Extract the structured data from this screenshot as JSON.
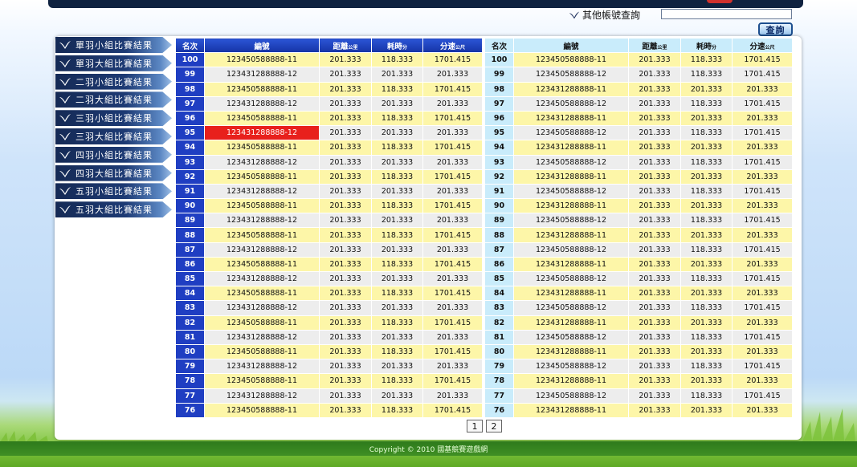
{
  "search": {
    "label": "其他帳號查詢",
    "input_value": "",
    "button_label": "查詢"
  },
  "sidebar": {
    "items": [
      {
        "label": "單羽小組比賽結果"
      },
      {
        "label": "單羽大組比賽結果"
      },
      {
        "label": "二羽小組比賽結果"
      },
      {
        "label": "二羽大組比賽結果"
      },
      {
        "label": "三羽小組比賽結果"
      },
      {
        "label": "三羽大組比賽結果"
      },
      {
        "label": "四羽小組比賽結果"
      },
      {
        "label": "四羽大組比賽結果"
      },
      {
        "label": "五羽小組比賽結果"
      },
      {
        "label": "五羽大組比賽結果"
      }
    ]
  },
  "table": {
    "headers": {
      "rank": "名次",
      "code": "編號",
      "distance": "距離",
      "distance_unit": "公里",
      "time": "耗時",
      "time_unit": "分",
      "speed": "分速",
      "speed_unit": "公尺"
    },
    "highlighted": {
      "rank": "95",
      "side": "left"
    },
    "left_rows": [
      {
        "rank": "100",
        "code": "123450588888-11",
        "distance": "201.333",
        "time": "118.333",
        "speed": "1701.415"
      },
      {
        "rank": "99",
        "code": "123431288888-12",
        "distance": "201.333",
        "time": "201.333",
        "speed": "201.333"
      },
      {
        "rank": "98",
        "code": "123450588888-11",
        "distance": "201.333",
        "time": "118.333",
        "speed": "1701.415"
      },
      {
        "rank": "97",
        "code": "123431288888-12",
        "distance": "201.333",
        "time": "201.333",
        "speed": "201.333"
      },
      {
        "rank": "96",
        "code": "123450588888-11",
        "distance": "201.333",
        "time": "118.333",
        "speed": "1701.415"
      },
      {
        "rank": "95",
        "code": "123431288888-12",
        "distance": "201.333",
        "time": "201.333",
        "speed": "201.333"
      },
      {
        "rank": "94",
        "code": "123450588888-11",
        "distance": "201.333",
        "time": "118.333",
        "speed": "1701.415"
      },
      {
        "rank": "93",
        "code": "123431288888-12",
        "distance": "201.333",
        "time": "201.333",
        "speed": "201.333"
      },
      {
        "rank": "92",
        "code": "123450588888-11",
        "distance": "201.333",
        "time": "118.333",
        "speed": "1701.415"
      },
      {
        "rank": "91",
        "code": "123431288888-12",
        "distance": "201.333",
        "time": "201.333",
        "speed": "201.333"
      },
      {
        "rank": "90",
        "code": "123450588888-11",
        "distance": "201.333",
        "time": "118.333",
        "speed": "1701.415"
      },
      {
        "rank": "89",
        "code": "123431288888-12",
        "distance": "201.333",
        "time": "201.333",
        "speed": "201.333"
      },
      {
        "rank": "88",
        "code": "123450588888-11",
        "distance": "201.333",
        "time": "118.333",
        "speed": "1701.415"
      },
      {
        "rank": "87",
        "code": "123431288888-12",
        "distance": "201.333",
        "time": "201.333",
        "speed": "201.333"
      },
      {
        "rank": "86",
        "code": "123450588888-11",
        "distance": "201.333",
        "time": "118.333",
        "speed": "1701.415"
      },
      {
        "rank": "85",
        "code": "123431288888-12",
        "distance": "201.333",
        "time": "201.333",
        "speed": "201.333"
      },
      {
        "rank": "84",
        "code": "123450588888-11",
        "distance": "201.333",
        "time": "118.333",
        "speed": "1701.415"
      },
      {
        "rank": "83",
        "code": "123431288888-12",
        "distance": "201.333",
        "time": "201.333",
        "speed": "201.333"
      },
      {
        "rank": "82",
        "code": "123450588888-11",
        "distance": "201.333",
        "time": "118.333",
        "speed": "1701.415"
      },
      {
        "rank": "81",
        "code": "123431288888-12",
        "distance": "201.333",
        "time": "201.333",
        "speed": "201.333"
      },
      {
        "rank": "80",
        "code": "123450588888-11",
        "distance": "201.333",
        "time": "118.333",
        "speed": "1701.415"
      },
      {
        "rank": "79",
        "code": "123431288888-12",
        "distance": "201.333",
        "time": "201.333",
        "speed": "201.333"
      },
      {
        "rank": "78",
        "code": "123450588888-11",
        "distance": "201.333",
        "time": "118.333",
        "speed": "1701.415"
      },
      {
        "rank": "77",
        "code": "123431288888-12",
        "distance": "201.333",
        "time": "201.333",
        "speed": "201.333"
      },
      {
        "rank": "76",
        "code": "123450588888-11",
        "distance": "201.333",
        "time": "118.333",
        "speed": "1701.415"
      }
    ],
    "right_rows": [
      {
        "rank": "100",
        "code": "123450588888-11",
        "distance": "201.333",
        "time": "118.333",
        "speed": "1701.415"
      },
      {
        "rank": "99",
        "code": "123450588888-12",
        "distance": "201.333",
        "time": "118.333",
        "speed": "1701.415"
      },
      {
        "rank": "98",
        "code": "123431288888-11",
        "distance": "201.333",
        "time": "201.333",
        "speed": "201.333"
      },
      {
        "rank": "97",
        "code": "123450588888-12",
        "distance": "201.333",
        "time": "118.333",
        "speed": "1701.415"
      },
      {
        "rank": "96",
        "code": "123431288888-11",
        "distance": "201.333",
        "time": "201.333",
        "speed": "201.333"
      },
      {
        "rank": "95",
        "code": "123450588888-12",
        "distance": "201.333",
        "time": "118.333",
        "speed": "1701.415"
      },
      {
        "rank": "94",
        "code": "123431288888-11",
        "distance": "201.333",
        "time": "201.333",
        "speed": "201.333"
      },
      {
        "rank": "93",
        "code": "123450588888-12",
        "distance": "201.333",
        "time": "118.333",
        "speed": "1701.415"
      },
      {
        "rank": "92",
        "code": "123431288888-11",
        "distance": "201.333",
        "time": "201.333",
        "speed": "201.333"
      },
      {
        "rank": "91",
        "code": "123450588888-12",
        "distance": "201.333",
        "time": "118.333",
        "speed": "1701.415"
      },
      {
        "rank": "90",
        "code": "123431288888-11",
        "distance": "201.333",
        "time": "201.333",
        "speed": "201.333"
      },
      {
        "rank": "89",
        "code": "123450588888-12",
        "distance": "201.333",
        "time": "118.333",
        "speed": "1701.415"
      },
      {
        "rank": "88",
        "code": "123431288888-11",
        "distance": "201.333",
        "time": "201.333",
        "speed": "201.333"
      },
      {
        "rank": "87",
        "code": "123450588888-12",
        "distance": "201.333",
        "time": "118.333",
        "speed": "1701.415"
      },
      {
        "rank": "86",
        "code": "123431288888-11",
        "distance": "201.333",
        "time": "201.333",
        "speed": "201.333"
      },
      {
        "rank": "85",
        "code": "123450588888-12",
        "distance": "201.333",
        "time": "118.333",
        "speed": "1701.415"
      },
      {
        "rank": "84",
        "code": "123431288888-11",
        "distance": "201.333",
        "time": "201.333",
        "speed": "201.333"
      },
      {
        "rank": "83",
        "code": "123450588888-12",
        "distance": "201.333",
        "time": "118.333",
        "speed": "1701.415"
      },
      {
        "rank": "82",
        "code": "123431288888-11",
        "distance": "201.333",
        "time": "201.333",
        "speed": "201.333"
      },
      {
        "rank": "81",
        "code": "123450588888-12",
        "distance": "201.333",
        "time": "118.333",
        "speed": "1701.415"
      },
      {
        "rank": "80",
        "code": "123431288888-11",
        "distance": "201.333",
        "time": "201.333",
        "speed": "201.333"
      },
      {
        "rank": "79",
        "code": "123450588888-12",
        "distance": "201.333",
        "time": "118.333",
        "speed": "1701.415"
      },
      {
        "rank": "78",
        "code": "123431288888-11",
        "distance": "201.333",
        "time": "201.333",
        "speed": "201.333"
      },
      {
        "rank": "77",
        "code": "123450588888-12",
        "distance": "201.333",
        "time": "118.333",
        "speed": "1701.415"
      },
      {
        "rank": "76",
        "code": "123431288888-11",
        "distance": "201.333",
        "time": "201.333",
        "speed": "201.333"
      }
    ]
  },
  "pagination": {
    "pages": [
      "1",
      "2"
    ]
  },
  "footer": {
    "copyright": "Copyright © 2010 國基競賽遊戲網"
  },
  "colors": {
    "header_blue": "#1f3ec2",
    "row_yellow": "#fdf6a8",
    "row_gray": "#ededed",
    "highlight_red": "#e8201c",
    "sidebar_navy": "#152a55"
  },
  "icons": {
    "sidebar_item": "bird-icon",
    "search_label": "bird-icon"
  }
}
